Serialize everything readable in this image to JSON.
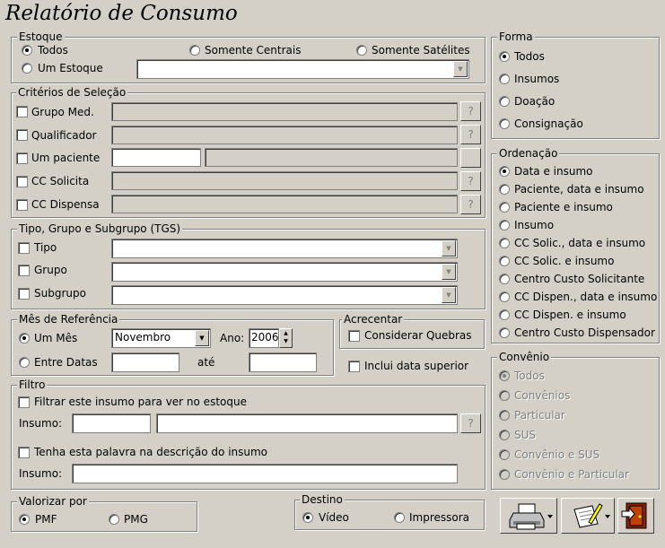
{
  "title": "Relatório de Consumo",
  "estoque": {
    "legend": "Estoque",
    "todos": "Todos",
    "centrais": "Somente Centrais",
    "satelites": "Somente Satélites",
    "um_estoque": "Um Estoque",
    "selected": "Todos"
  },
  "criterios": {
    "legend": "Critérios de Seleção",
    "grupo_med": "Grupo Med.",
    "qualificador": "Qualificador",
    "um_paciente": "Um paciente",
    "cc_solicita": "CC Solicita",
    "cc_dispensa": "CC Dispensa",
    "help": "?"
  },
  "tgs": {
    "legend": "Tipo, Grupo e Subgrupo (TGS)",
    "tipo": "Tipo",
    "grupo": "Grupo",
    "subgrupo": "Subgrupo"
  },
  "mes": {
    "legend": "Mês de Referência",
    "um_mes": "Um Mês",
    "entre_datas": "Entre Datas",
    "month_value": "Novembro",
    "ano_label": "Ano:",
    "ano_value": "2006",
    "ate": "até",
    "selected": "Um Mês"
  },
  "acrescentar": {
    "legend": "Acrecentar",
    "quebras": "Considerar Quebras",
    "data_superior": "Inclui data superior"
  },
  "filtro": {
    "legend": "Filtro",
    "filtrar_insumo": "Filtrar este insumo para ver no estoque",
    "insumo_label": "Insumo:",
    "palavra": "Tenha esta palavra na descrição do insumo"
  },
  "valorizar": {
    "legend": "Valorizar por",
    "pmf": "PMF",
    "pmg": "PMG",
    "selected": "PMF"
  },
  "destino": {
    "legend": "Destino",
    "video": "Vídeo",
    "impressora": "Impressora",
    "selected": "Vídeo"
  },
  "forma": {
    "legend": "Forma",
    "options": [
      "Todos",
      "Insumos",
      "Doação",
      "Consignação"
    ],
    "selected": "Todos"
  },
  "ordenacao": {
    "legend": "Ordenação",
    "options": [
      "Data e insumo",
      "Paciente, data e insumo",
      "Paciente e insumo",
      "Insumo",
      "CC Solic., data e insumo",
      "CC Solic. e insumo",
      "Centro Custo Solicitante",
      "CC Dispen., data e insumo",
      "CC Dispen. e insumo",
      "Centro Custo Dispensador"
    ],
    "selected": "Data e insumo"
  },
  "convenio": {
    "legend": "Convênio",
    "options": [
      "Todos",
      "Convênios",
      "Particular",
      "SUS",
      "Convênio e SUS",
      "Convênio e Particular"
    ],
    "selected": "Todos"
  },
  "icons": {
    "print": "printer-icon",
    "edit": "document-edit-icon",
    "exit": "door-exit-icon"
  }
}
